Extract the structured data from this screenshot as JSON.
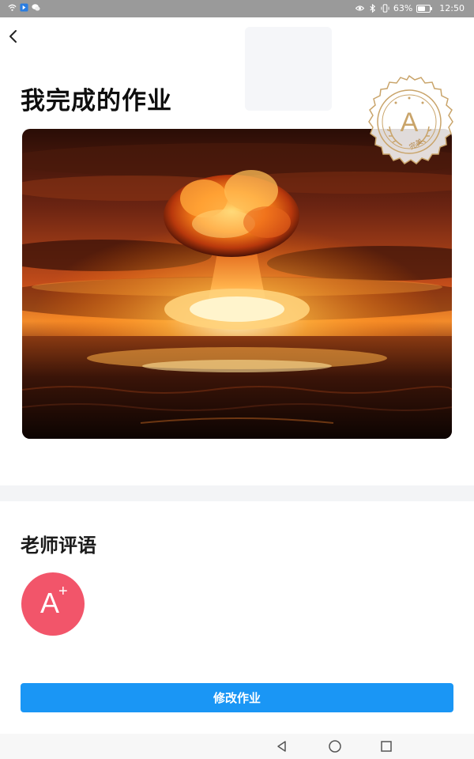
{
  "status_bar": {
    "battery_percent": "63%",
    "battery_level": 0.63,
    "time": "12:50",
    "icons": [
      "wifi-icon",
      "app-notification-icon",
      "wechat-icon",
      "eye-icon",
      "bluetooth-icon",
      "vibrate-icon",
      "battery-icon"
    ]
  },
  "header": {
    "back_icon": "chevron-left-icon",
    "title": "我完成的作业"
  },
  "homework": {
    "image": "nuclear-explosion-mushroom-cloud",
    "stamp": {
      "grade": "A",
      "text": "完美"
    }
  },
  "comment": {
    "title": "老师评语",
    "grade_letter": "A",
    "grade_mark": "+",
    "badge_color": "#f2556a"
  },
  "actions": {
    "modify_label": "修改作业",
    "accent": "#1a96f5"
  },
  "nav_bar": {
    "icons": [
      "back-triangle-icon",
      "home-circle-icon",
      "recents-square-icon"
    ]
  }
}
